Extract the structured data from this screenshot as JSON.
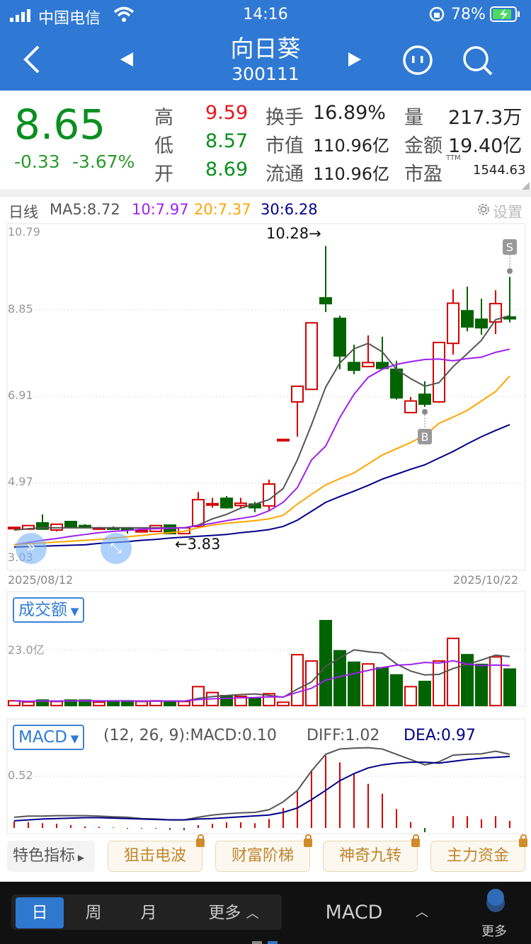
{
  "status": {
    "carrier": "中国电信",
    "time": "14:16",
    "battery": "78%"
  },
  "nav": {
    "title": "向日葵",
    "code": "300111"
  },
  "quote": {
    "price": "8.65",
    "change": "-0.33",
    "change_pct": "-3.67%",
    "rows": [
      {
        "l1": "高",
        "v1": "9.59",
        "l2": "换手",
        "v2": "16.89%",
        "l3": "量",
        "v3": "217.3万"
      },
      {
        "l1": "低",
        "v1": "8.57",
        "l2": "市值",
        "v2": "110.96亿",
        "l3": "金额",
        "v3": "19.40亿"
      },
      {
        "l1": "开",
        "v1": "8.69",
        "l2": "流通",
        "v2": "110.96亿",
        "l3": "市盈",
        "v3": "1544.63",
        "sup": "TTM"
      }
    ]
  },
  "colors": {
    "up": "#d40000",
    "down": "#006400",
    "ma5": "#555555",
    "ma10": "#a020f0",
    "ma20": "#ffa500",
    "ma30": "#00008b",
    "accent": "#2f79d4"
  },
  "legend": {
    "period": "日线",
    "ma5": "MA5:8.72",
    "ma10": "10:7.97",
    "ma20": "20:7.37",
    "ma30": "30:6.28",
    "settings": "设置"
  },
  "chart_data": [
    {
      "type": "candlestick",
      "ylim": [
        3.03,
        10.79
      ],
      "ytick_labels": [
        "10.79",
        "8.85",
        "6.91",
        "4.97",
        "3.03"
      ],
      "yticks": [
        10.79,
        8.85,
        6.91,
        4.97,
        3.03
      ],
      "x_start": "2025/08/12",
      "x_end": "2025/10/22",
      "max_label": "10.28→",
      "min_label": "←3.83",
      "markers": {
        "buy": "B",
        "sell": "S"
      },
      "ohlc": [
        [
          3.97,
          3.98,
          3.99,
          3.95
        ],
        [
          3.94,
          4.02,
          4.03,
          3.93
        ],
        [
          4.08,
          3.94,
          4.27,
          3.94
        ],
        [
          3.92,
          4.05,
          4.05,
          3.89
        ],
        [
          4.11,
          3.98,
          4.11,
          3.98
        ],
        [
          4.02,
          4.01,
          4.05,
          3.99
        ],
        [
          3.97,
          3.97,
          3.99,
          3.95
        ],
        [
          3.97,
          3.96,
          4.0,
          3.93
        ],
        [
          3.97,
          3.92,
          3.97,
          3.84
        ],
        [
          3.91,
          3.91,
          3.95,
          3.87
        ],
        [
          3.89,
          4.02,
          4.02,
          3.89
        ],
        [
          4.03,
          3.84,
          4.03,
          3.84
        ],
        [
          3.84,
          3.97,
          3.97,
          3.83
        ],
        [
          4.0,
          4.6,
          4.77,
          4.0
        ],
        [
          4.5,
          4.51,
          4.64,
          4.42
        ],
        [
          4.63,
          4.42,
          4.68,
          4.4
        ],
        [
          4.47,
          4.52,
          4.64,
          4.42
        ],
        [
          4.5,
          4.42,
          4.55,
          4.32
        ],
        [
          4.46,
          4.95,
          5.05,
          4.36
        ],
        [
          5.95,
          5.95,
          5.95,
          5.95
        ],
        [
          6.79,
          7.14,
          7.14,
          6.01
        ],
        [
          7.07,
          8.56,
          8.56,
          7.07
        ],
        [
          9.12,
          8.99,
          10.28,
          8.8
        ],
        [
          8.66,
          7.82,
          8.72,
          7.52
        ],
        [
          7.67,
          7.5,
          8.07,
          7.41
        ],
        [
          7.58,
          7.67,
          8.28,
          7.58
        ],
        [
          7.67,
          7.54,
          8.25,
          7.54
        ],
        [
          7.52,
          6.88,
          7.71,
          6.84
        ],
        [
          6.55,
          6.81,
          6.9,
          6.55
        ],
        [
          6.96,
          6.74,
          7.25,
          6.68
        ],
        [
          6.79,
          8.12,
          8.12,
          6.77
        ],
        [
          8.1,
          9.0,
          9.31,
          7.85
        ],
        [
          8.83,
          8.47,
          9.37,
          8.37
        ],
        [
          8.64,
          8.45,
          9.1,
          8.29
        ],
        [
          8.58,
          8.99,
          9.29,
          8.31
        ],
        [
          8.69,
          8.65,
          9.59,
          8.57
        ]
      ],
      "ma5": [
        3.92,
        3.95,
        3.97,
        3.97,
        3.97,
        3.97,
        3.97,
        3.97,
        3.97,
        3.97,
        3.97,
        3.97,
        3.97,
        4.03,
        4.17,
        4.27,
        4.41,
        4.5,
        4.6,
        4.85,
        5.49,
        6.28,
        7.12,
        7.66,
        7.98,
        8.1,
        7.91,
        7.52,
        7.31,
        7.14,
        7.22,
        7.58,
        7.87,
        8.17,
        8.63,
        8.72
      ],
      "ma10": [
        3.59,
        3.64,
        3.69,
        3.73,
        3.78,
        3.82,
        3.86,
        3.89,
        3.91,
        3.94,
        3.95,
        3.96,
        3.97,
        4.02,
        4.07,
        4.13,
        4.18,
        4.23,
        4.35,
        4.54,
        4.87,
        5.49,
        5.8,
        6.44,
        6.96,
        7.34,
        7.52,
        7.63,
        7.69,
        7.74,
        7.75,
        7.71,
        7.76,
        7.79,
        7.9,
        7.97
      ],
      "ma20": [
        3.59,
        3.61,
        3.63,
        3.65,
        3.67,
        3.69,
        3.71,
        3.74,
        3.77,
        3.8,
        3.83,
        3.86,
        3.89,
        3.97,
        4.03,
        4.07,
        4.1,
        4.13,
        4.17,
        4.25,
        4.5,
        4.72,
        4.93,
        5.07,
        5.2,
        5.4,
        5.6,
        5.74,
        5.88,
        6.04,
        6.31,
        6.45,
        6.6,
        6.81,
        7.02,
        7.37
      ],
      "ma30": [
        3.54,
        3.55,
        3.56,
        3.57,
        3.58,
        3.59,
        3.62,
        3.64,
        3.66,
        3.69,
        3.71,
        3.74,
        3.76,
        3.78,
        3.8,
        3.82,
        3.86,
        3.89,
        3.93,
        4.0,
        4.14,
        4.34,
        4.54,
        4.67,
        4.79,
        4.92,
        5.06,
        5.17,
        5.28,
        5.38,
        5.53,
        5.68,
        5.85,
        6.01,
        6.15,
        6.28
      ]
    },
    {
      "type": "bar",
      "title": "成交额",
      "ytick_label": "23.0亿",
      "ytick": 23.0,
      "unit": "亿",
      "values": [
        1.94,
        1.46,
        2.23,
        1.65,
        2.23,
        2.23,
        1.36,
        1.94,
        1.94,
        1.65,
        1.94,
        1.65,
        1.65,
        7.76,
        5.34,
        4.07,
        3.78,
        2.91,
        4.85,
        1.36,
        20.9,
        18.3,
        34.9,
        22.5,
        17.8,
        17.1,
        15.5,
        12.6,
        7.76,
        9.89,
        18.3,
        27.6,
        20.9,
        16.9,
        20.0,
        15.0
      ]
    },
    {
      "type": "line",
      "title": "MACD",
      "params": "(12, 26, 9):MACD:0.10",
      "diff_label": "DIFF:1.02",
      "dea_label": "DEA:0.97",
      "ytick_label": "0.52",
      "ytick": 0.52,
      "diff": [
        -0.41,
        -0.385,
        -0.385,
        -0.375,
        -0.375,
        -0.375,
        -0.385,
        -0.4,
        -0.41,
        -0.44,
        -0.45,
        -0.47,
        -0.47,
        -0.41,
        -0.36,
        -0.33,
        -0.31,
        -0.3,
        -0.24,
        -0.06,
        0.2,
        0.64,
        1.02,
        1.14,
        1.16,
        1.17,
        1.14,
        1.02,
        0.9,
        0.78,
        0.85,
        1.0,
        1.02,
        1.03,
        1.09,
        1.02
      ],
      "dea": [
        -0.49,
        -0.47,
        -0.45,
        -0.44,
        -0.43,
        -0.42,
        -0.42,
        -0.43,
        -0.44,
        -0.45,
        -0.46,
        -0.47,
        -0.47,
        -0.45,
        -0.44,
        -0.42,
        -0.4,
        -0.38,
        -0.36,
        -0.3,
        -0.2,
        -0.01,
        0.2,
        0.42,
        0.58,
        0.71,
        0.78,
        0.82,
        0.84,
        0.84,
        0.82,
        0.86,
        0.9,
        0.93,
        0.95,
        0.97
      ],
      "macd": [
        0.093,
        0.083,
        0.067,
        0.06,
        0.04,
        0.023,
        0.017,
        0.007,
        -0.01,
        -0.01,
        -0.01,
        -0.027,
        -0.033,
        0.04,
        0.06,
        0.08,
        0.08,
        0.067,
        0.127,
        0.283,
        0.517,
        0.817,
        1.023,
        0.927,
        0.76,
        0.623,
        0.483,
        0.267,
        0.083,
        -0.06,
        0.0,
        0.167,
        0.167,
        0.123,
        0.167,
        0.1
      ]
    }
  ],
  "indicators": {
    "label": "特色指标",
    "items": [
      "狙击电波",
      "财富阶梯",
      "神奇九转",
      "主力资金"
    ]
  },
  "bottom": {
    "periods": [
      "日",
      "周",
      "月",
      "更多"
    ],
    "indicator": "MACD",
    "more": "更多"
  }
}
